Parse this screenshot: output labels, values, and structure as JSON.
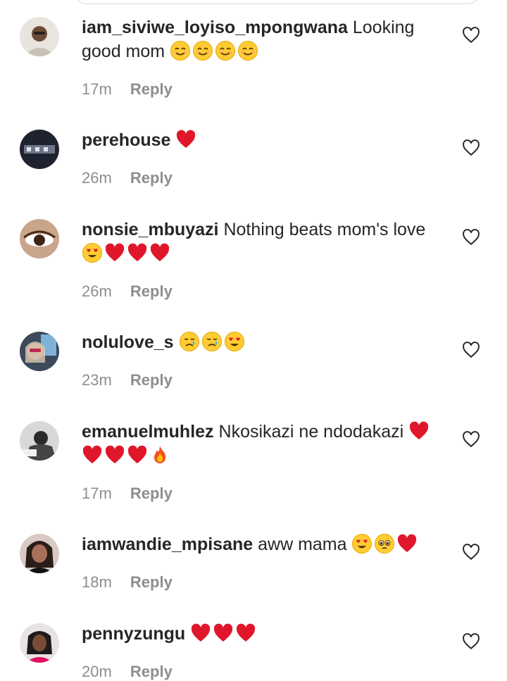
{
  "reply_label": "Reply",
  "colors": {
    "username": "#262626",
    "meta": "#8e8e8e",
    "heart_emoji": "#e0162b"
  },
  "comments": [
    {
      "username": "iam_siviwe_loyiso_mpongwana",
      "text": "Looking good mom",
      "emojis": [
        "smile",
        "smile",
        "smile",
        "smile"
      ],
      "time": "17m"
    },
    {
      "username": "perehouse",
      "text": "",
      "emojis": [
        "heart"
      ],
      "time": "26m"
    },
    {
      "username": "nonsie_mbuyazi",
      "text": "Nothing beats mom's love",
      "emojis": [
        "heart-eyes",
        "heart",
        "heart",
        "heart"
      ],
      "time": "26m"
    },
    {
      "username": "nolulove_s",
      "text": "",
      "emojis": [
        "crying",
        "crying",
        "heart-eyes"
      ],
      "time": "23m"
    },
    {
      "username": "emanuelmuhlez",
      "text": "Nkosikazi ne ndodakazi",
      "emojis": [
        "heart",
        "heart",
        "heart",
        "heart",
        "fire"
      ],
      "time": "17m"
    },
    {
      "username": "iamwandie_mpisane",
      "text": "aww mama",
      "emojis": [
        "heart-eyes",
        "pleading",
        "heart"
      ],
      "time": "18m"
    },
    {
      "username": "pennyzungu",
      "text": "",
      "emojis": [
        "heart",
        "heart",
        "heart"
      ],
      "time": "20m"
    }
  ]
}
